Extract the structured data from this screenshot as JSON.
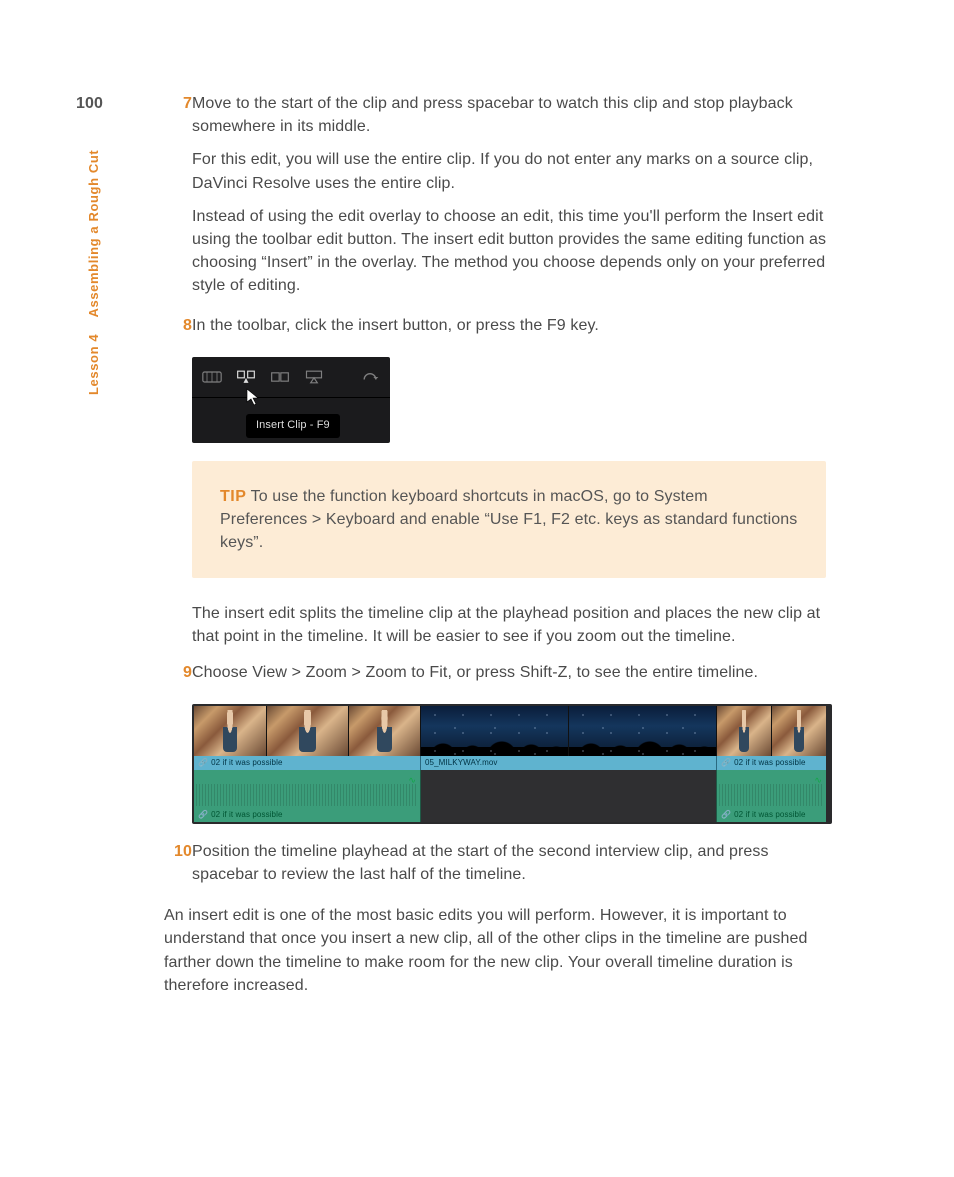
{
  "page_number": "100",
  "side": {
    "lesson_label": "Lesson 4",
    "title": "Assembling a Rough Cut"
  },
  "steps": {
    "s7": {
      "num": "7",
      "p1": "Move to the start of the clip and press spacebar to watch this clip and stop playback somewhere in its middle.",
      "p2": "For this edit, you will use the entire clip. If you do not enter any marks on a source clip, DaVinci Resolve uses the entire clip.",
      "p3": "Instead of using the edit overlay to choose an edit, this time you'll perform the Insert edit using the toolbar edit button. The insert edit button provides the same editing function as choosing “Insert” in the overlay. The method you choose depends only on your preferred style of editing."
    },
    "s8": {
      "num": "8",
      "p1": "In the toolbar, click the insert button, or press the F9 key."
    },
    "s9": {
      "num": "9",
      "p1": "Choose View > Zoom > Zoom to Fit, or press Shift-Z, to see the entire timeline."
    },
    "s10": {
      "num": "10",
      "p1": "Position the timeline playhead at the start of the second interview clip, and press spacebar to review the last half of the timeline."
    }
  },
  "toolbar": {
    "tooltip": "Insert Clip - F9"
  },
  "tip": {
    "label": "TIP",
    "text": "  To use the function keyboard shortcuts in macOS, go to System Preferences > Keyboard and enable “Use F1, F2 etc. keys as standard functions keys”."
  },
  "mid_para": "The insert edit splits the timeline clip at the playhead position and places the new clip at that point in the timeline. It will be easier to see if you zoom out the timeline.",
  "timeline": {
    "clip_a_label": "02 if it was possible",
    "clip_b_label": "05_MILKYWAY.mov",
    "clip_c_label": "02 if it was possible"
  },
  "closing": "An insert edit is one of the most basic edits you will perform. However, it is important to understand that once you insert a new clip, all of the other clips in the timeline are pushed farther down the timeline to make room for the new clip. Your overall timeline duration is therefore increased."
}
